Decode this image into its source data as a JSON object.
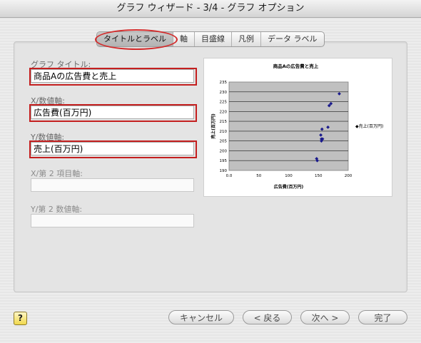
{
  "window": {
    "title": "グラフ ウィザード - 3/4 - グラフ オプション"
  },
  "tabs": [
    "タイトルとラベル",
    "軸",
    "目盛線",
    "凡例",
    "データ ラベル"
  ],
  "fields": {
    "chart_title_label": "グラフ タイトル:",
    "chart_title_value": "商品Aの広告費と売上",
    "x_axis_label": "X/数値軸:",
    "x_axis_value": "広告費(百万円)",
    "y_axis_label": "Y/数値軸:",
    "y_axis_value": "売上(百万円)",
    "x2_axis_label": "X/第 2 項目軸:",
    "x2_axis_value": "",
    "y2_axis_label": "Y/第 2 数値軸:",
    "y2_axis_value": ""
  },
  "buttons": {
    "help": "?",
    "cancel": "キャンセル",
    "back": "< 戻る",
    "next": "次へ >",
    "finish": "完了"
  },
  "chart_data": {
    "type": "scatter",
    "title": "商品Aの広告費と売上",
    "xlabel": "広告費(百万円)",
    "ylabel": "売上(百万円)",
    "xlim": [
      0,
      200
    ],
    "ylim": [
      190,
      235
    ],
    "xticks": [
      "0.0",
      "50",
      "100",
      "150",
      "200"
    ],
    "yticks": [
      "190",
      "195",
      "200",
      "205",
      "210",
      "215",
      "220",
      "225",
      "230",
      "235"
    ],
    "legend": "◆売上(百万円)",
    "grid": "horizontal",
    "marker_color": "#1a1a8c",
    "points": [
      {
        "x": 148,
        "y": 195
      },
      {
        "x": 147,
        "y": 196
      },
      {
        "x": 155,
        "y": 205
      },
      {
        "x": 155,
        "y": 206
      },
      {
        "x": 157,
        "y": 206
      },
      {
        "x": 154,
        "y": 208
      },
      {
        "x": 156,
        "y": 211
      },
      {
        "x": 166,
        "y": 212
      },
      {
        "x": 168,
        "y": 223
      },
      {
        "x": 171,
        "y": 224
      },
      {
        "x": 185,
        "y": 229
      }
    ]
  }
}
